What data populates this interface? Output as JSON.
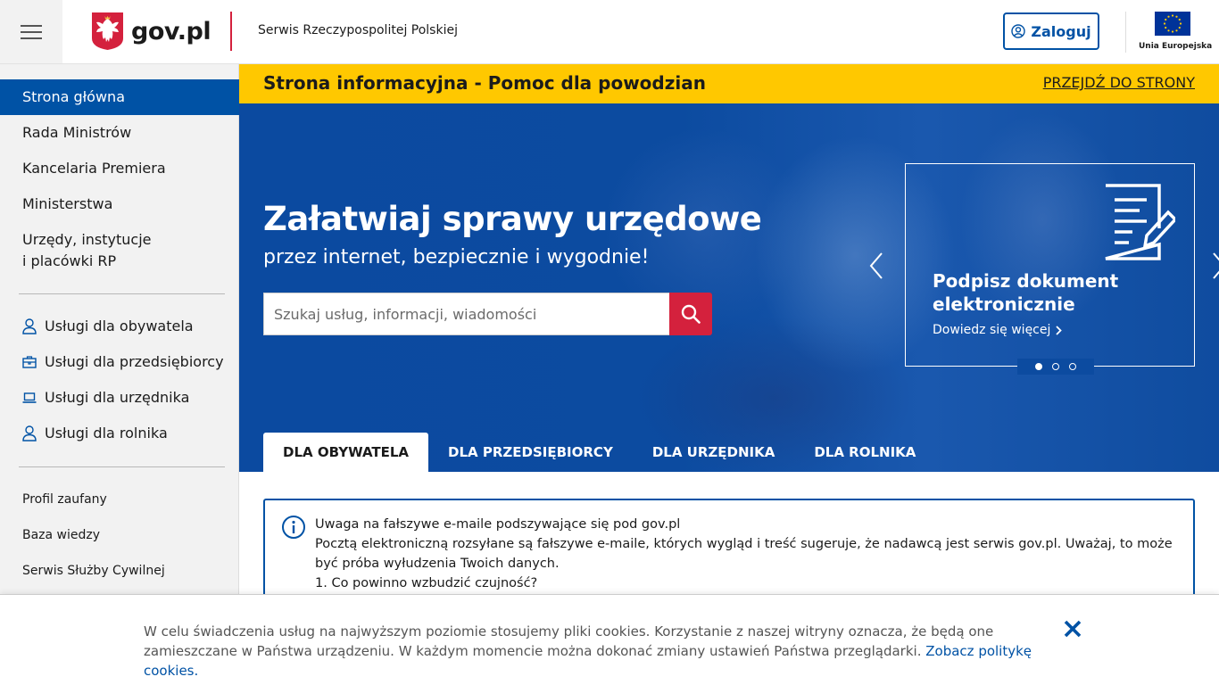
{
  "header": {
    "logo_text": "gov.pl",
    "service_name": "Serwis Rzeczypospolitej Polskiej",
    "login_label": "Zaloguj",
    "eu_label": "Unia Europejska"
  },
  "sidebar": {
    "main_items": [
      {
        "label": "Strona główna",
        "active": true
      },
      {
        "label": "Rada Ministrów"
      },
      {
        "label": "Kancelaria Premiera"
      },
      {
        "label": "Ministerstwa"
      },
      {
        "label": "Urzędy, instytucje",
        "label2": "i placówki RP"
      }
    ],
    "services": [
      {
        "label": "Usługi dla obywatela",
        "icon": "person-icon"
      },
      {
        "label": "Usługi dla przedsiębiorcy",
        "icon": "briefcase-icon"
      },
      {
        "label": "Usługi dla urzędnika",
        "icon": "laptop-icon"
      },
      {
        "label": "Usługi dla rolnika",
        "icon": "person-icon"
      }
    ],
    "links": [
      {
        "label": "Profil zaufany"
      },
      {
        "label": "Baza wiedzy"
      },
      {
        "label": "Serwis Służby Cywilnej"
      }
    ]
  },
  "banner": {
    "title": "Strona informacyjna - Pomoc dla powodzian",
    "link": "PRZEJDŹ DO STRONY"
  },
  "hero": {
    "title": "Załatwiaj sprawy urzędowe",
    "subtitle": "przez internet, bezpiecznie i wygodnie!",
    "search_placeholder": "Szukaj usług, informacji, wiadomości",
    "promo_title": "Podpisz dokument elektronicznie",
    "promo_link": "Dowiedz się więcej",
    "active_slide": 1,
    "slide_count": 3
  },
  "tabs": [
    {
      "label": "DLA OBYWATELA",
      "active": true
    },
    {
      "label": "DLA PRZEDSIĘBIORCY"
    },
    {
      "label": "DLA URZĘDNIKA"
    },
    {
      "label": "DLA ROLNIKA"
    }
  ],
  "alert": {
    "title": "Uwaga na fałszywe e-maile podszywające się pod gov.pl",
    "body": "Pocztą elektroniczną rozsyłane są fałszywe e-maile, których wygląd i treść sugeruje, że nadawcą jest serwis gov.pl. Uważaj, to może być próba wyłudzenia Twoich danych.",
    "item1": "1. Co powinno wzbudzić czujność?"
  },
  "cookie": {
    "text": "W celu świadczenia usług na najwyższym poziomie stosujemy pliki cookies. Korzystanie z naszej witryny oznacza, że będą one zamieszczane w Państwa urządzeniu. W każdym momencie można dokonać zmiany ustawień Państwa przeglądarki.",
    "link": "Zobacz politykę cookies."
  },
  "colors": {
    "primary": "#0052a5",
    "accent_red": "#d4213d",
    "banner_yellow": "#ffc800"
  }
}
